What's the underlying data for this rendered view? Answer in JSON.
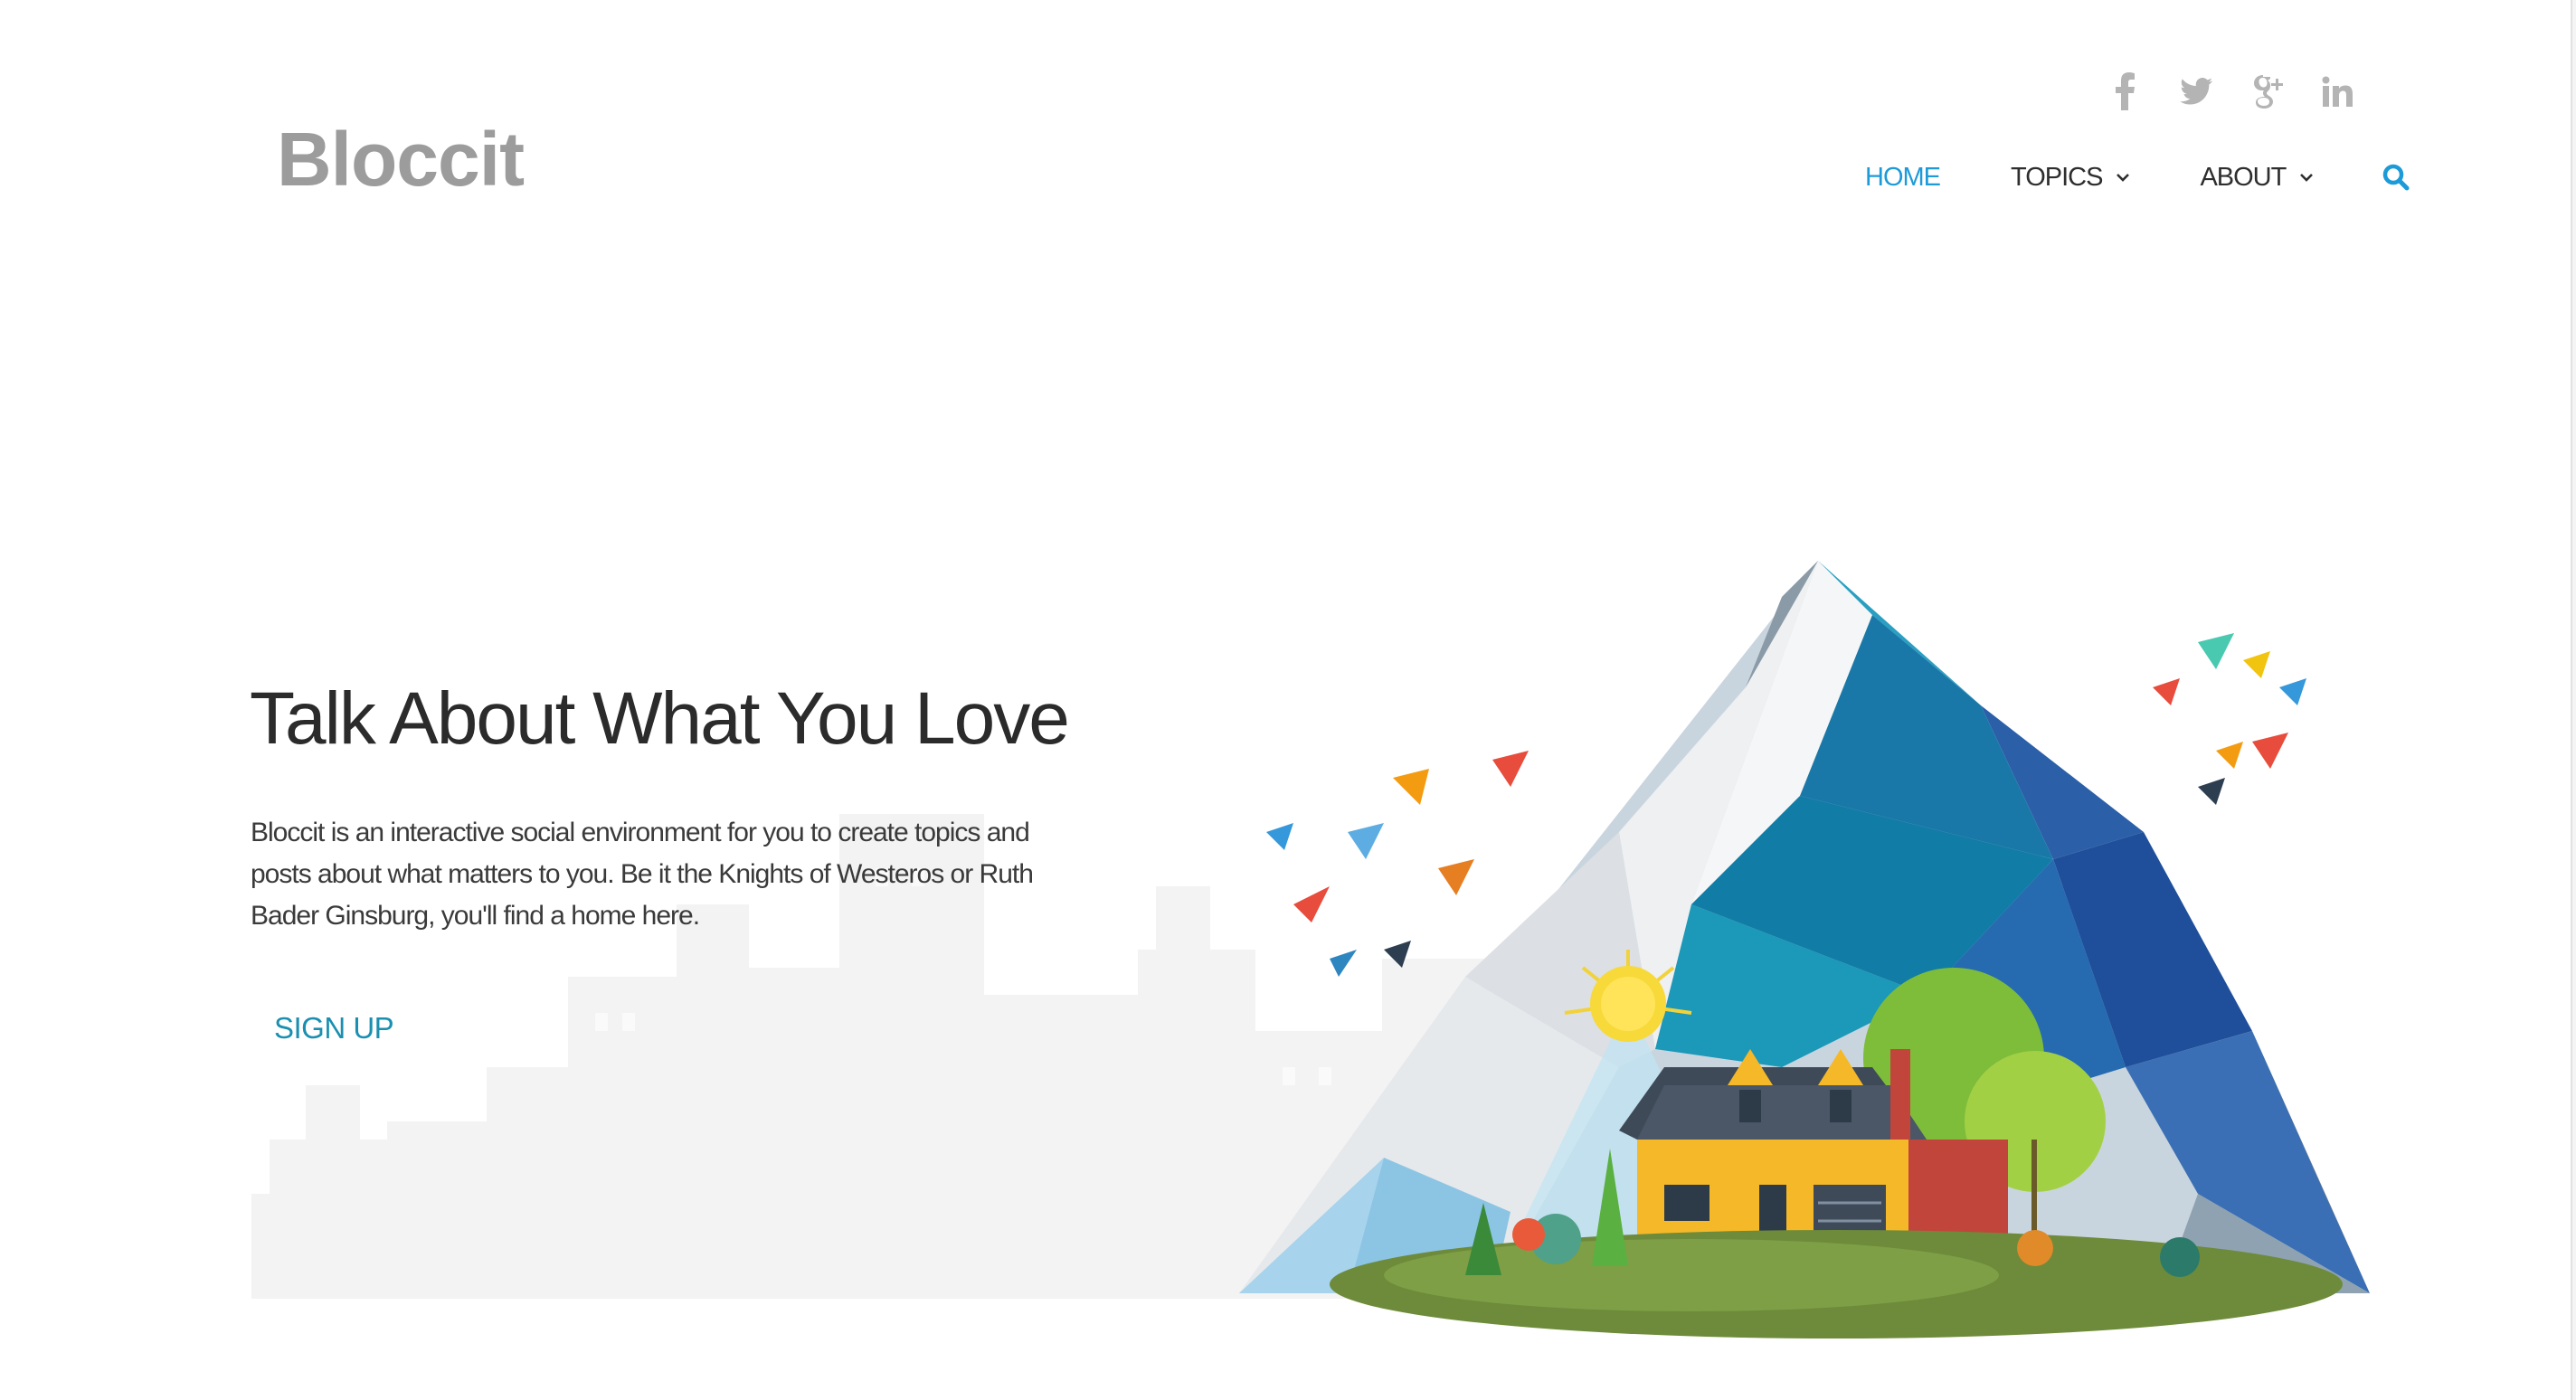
{
  "header": {
    "logo_text": "Bloccit",
    "social": [
      {
        "icon": "facebook-icon"
      },
      {
        "icon": "twitter-icon"
      },
      {
        "icon": "google-plus-icon"
      },
      {
        "icon": "linkedin-icon"
      }
    ],
    "nav": {
      "home": "HOME",
      "topics": "TOPICS",
      "about": "ABOUT",
      "search_icon": "search-icon"
    }
  },
  "hero": {
    "title": "Talk About What You Love",
    "description": "Bloccit is an interactive social environment for you to create topics and posts about what matters to you. Be it the Knights of Westeros or Ruth Bader Ginsburg, you'll find a home here.",
    "cta": "SIGN UP"
  },
  "colors": {
    "accent": "#1d9ad8",
    "cta": "#1a8fb0",
    "logo": "#9c9c9c",
    "social": "#b4b4b4"
  }
}
